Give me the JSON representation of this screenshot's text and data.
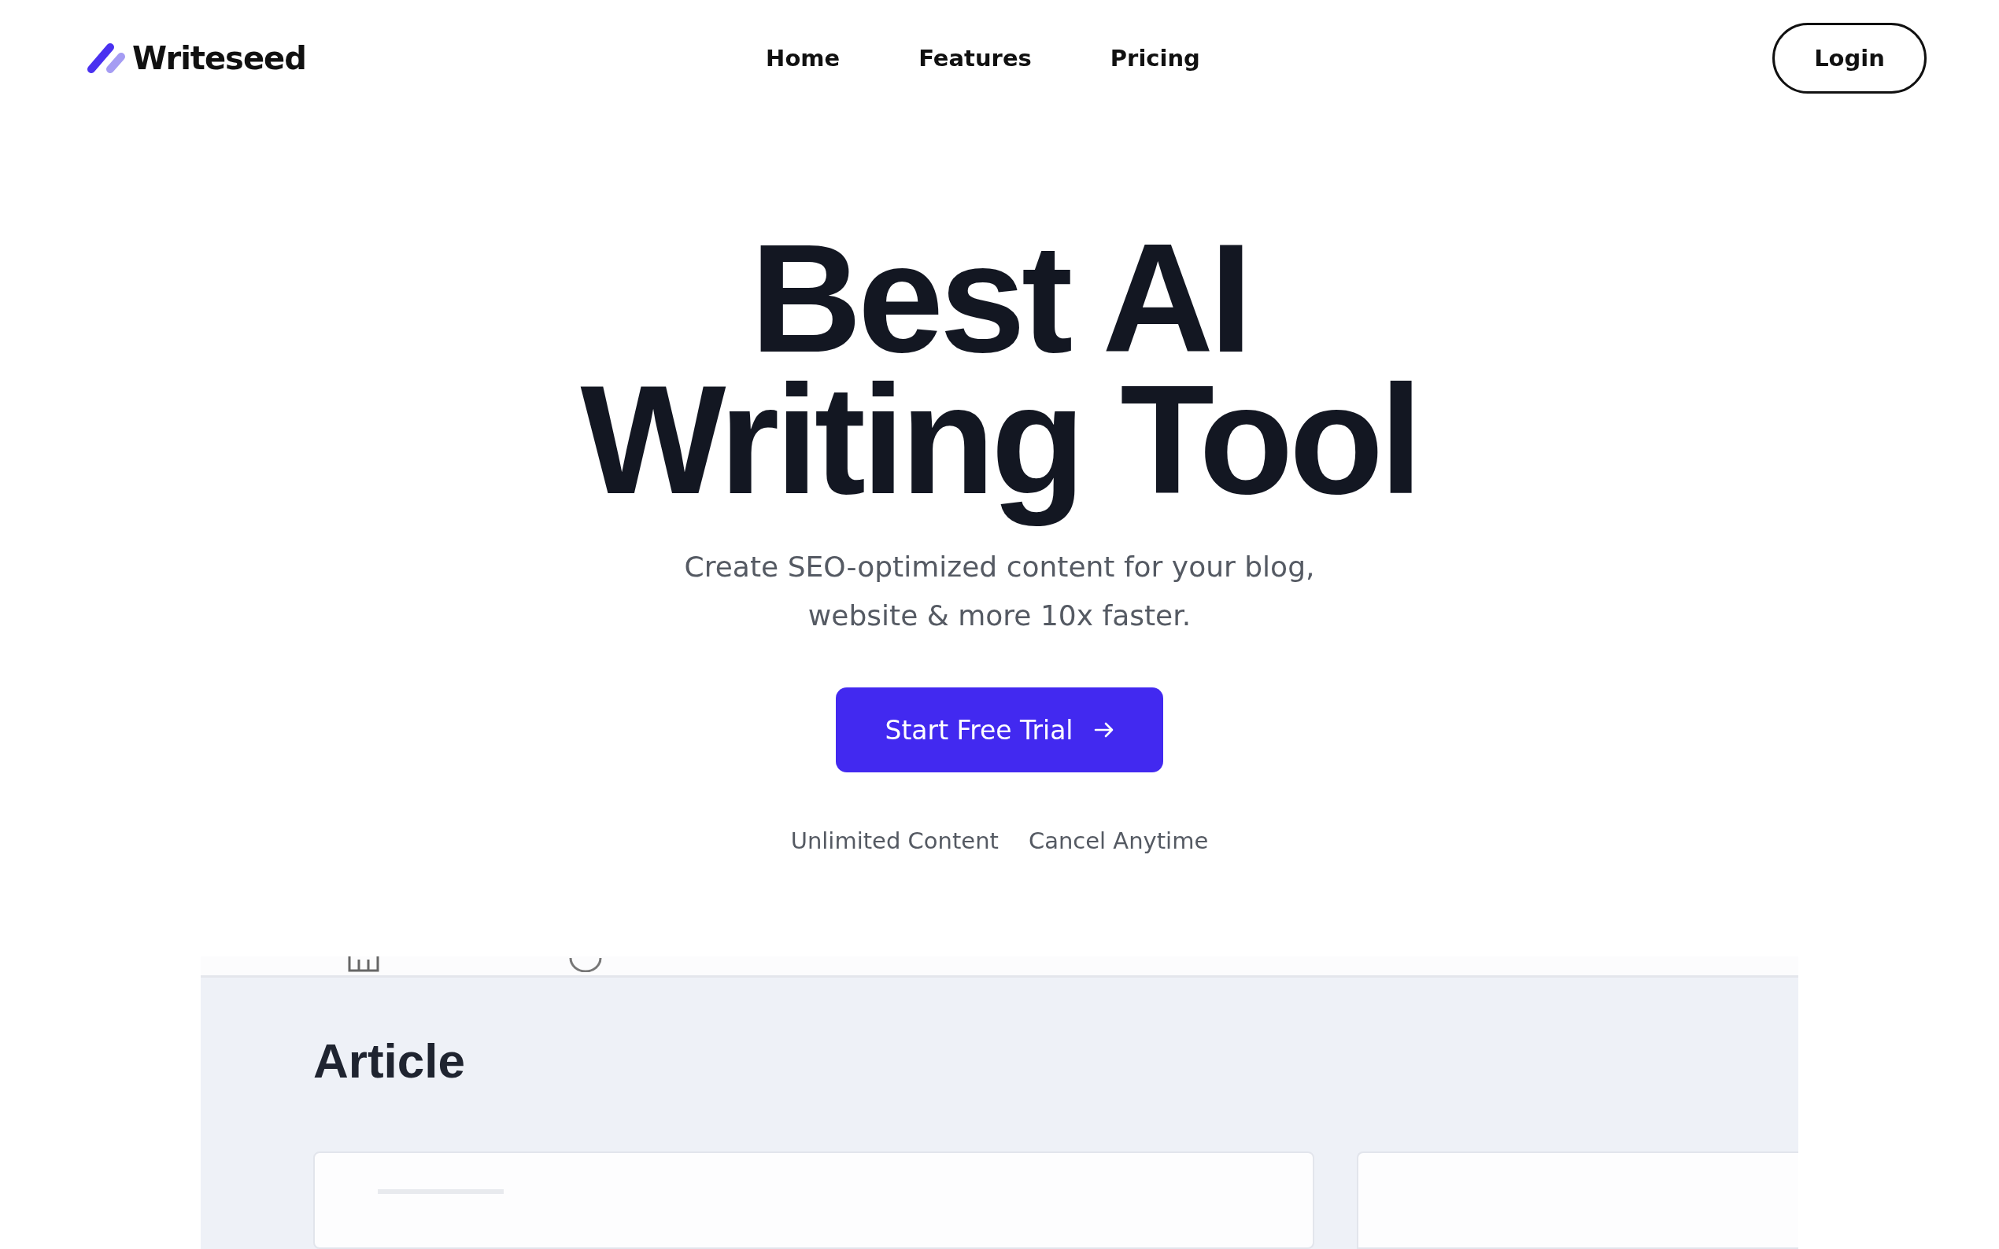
{
  "header": {
    "logo_text": "Writeseed",
    "nav": [
      {
        "label": "Home"
      },
      {
        "label": "Features"
      },
      {
        "label": "Pricing"
      }
    ],
    "login": "Login"
  },
  "hero": {
    "title_lines": [
      "Best AI",
      "Writing Tool"
    ],
    "subtitle_lines": [
      "Create SEO-optimized content for your blog,",
      "website & more 10x faster."
    ],
    "cta": "Start Free Trial",
    "perks": [
      "Unlimited Content",
      "Cancel Anytime"
    ]
  },
  "app_preview": {
    "heading": "Article"
  }
}
